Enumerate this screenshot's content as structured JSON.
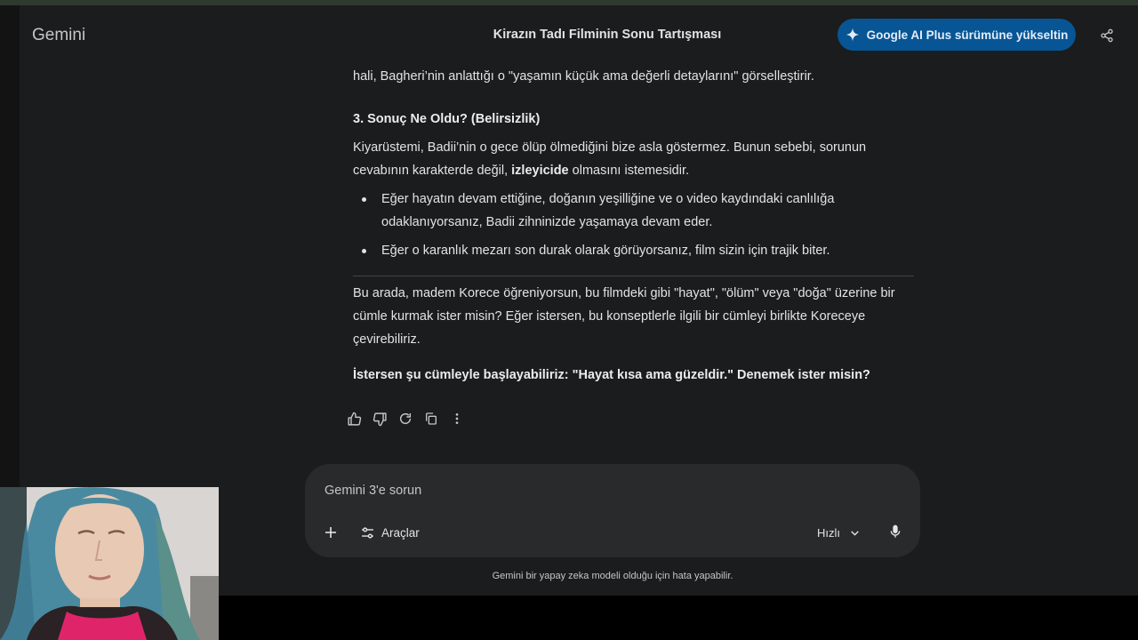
{
  "header": {
    "brand": "Gemini",
    "chat_title": "Kirazın Tadı Filminin Sonu Tartışması",
    "upgrade_label": "Google AI Plus sürümüne yükseltin"
  },
  "response": {
    "intro_line": "hali, Bagheri’nin anlattığı o \"yaşamın küçük ama değerli detaylarını\" görselleştirir.",
    "section_heading": "3. Sonuç Ne Oldu? (Belirsizlik)",
    "para1_a": "Kiyarüstemi, Badii’nin o gece ölüp ölmediğini bize asla göstermez. Bunun sebebi, sorunun",
    "para1_b_pre": "cevabının karakterde değil, ",
    "para1_b_bold": "izleyicide",
    "para1_b_post": " olmasını istemesidir.",
    "bullets": [
      {
        "line1": "Eğer hayatın devam ettiğine, doğanın yeşilliğine ve o video kaydındaki canlılığa",
        "line2": "odaklanıyorsanız, Badii zihninizde yaşamaya devam eder."
      },
      {
        "line1": "Eğer o karanlık mezarı son durak olarak görüyorsanız, film sizin için trajik biter.",
        "line2": ""
      }
    ],
    "para2_l1": "Bu arada, madem Korece öğreniyorsun, bu filmdeki gibi \"hayat\", \"ölüm\" veya \"doğa\" üzerine bir",
    "para2_l2": "cümle kurmak ister misin? Eğer istersen, bu konseptlerle ilgili bir cümleyi birlikte Koreceye",
    "para2_l3": "çevirebiliriz.",
    "closing": "İstersen şu cümleyle başlayabiliriz: \"Hayat kısa ama güzeldir.\" Denemek ister misin?"
  },
  "composer": {
    "placeholder": "Gemini 3'e sorun",
    "tools_label": "Araçlar",
    "speed_label": "Hızlı"
  },
  "disclaimer": "Gemini bir yapay zeka modeli olduğu için hata yapabilir.",
  "colors": {
    "background": "#1b1c1d",
    "composer": "#282a2c",
    "upgrade_button": "#075594",
    "text": "#e3e3e3"
  },
  "icons": [
    "sparkle-icon",
    "share-icon",
    "thumbs-up-icon",
    "thumbs-down-icon",
    "refresh-icon",
    "copy-icon",
    "more-vert-icon",
    "plus-icon",
    "tools-icon",
    "chevron-down-icon",
    "mic-icon"
  ]
}
